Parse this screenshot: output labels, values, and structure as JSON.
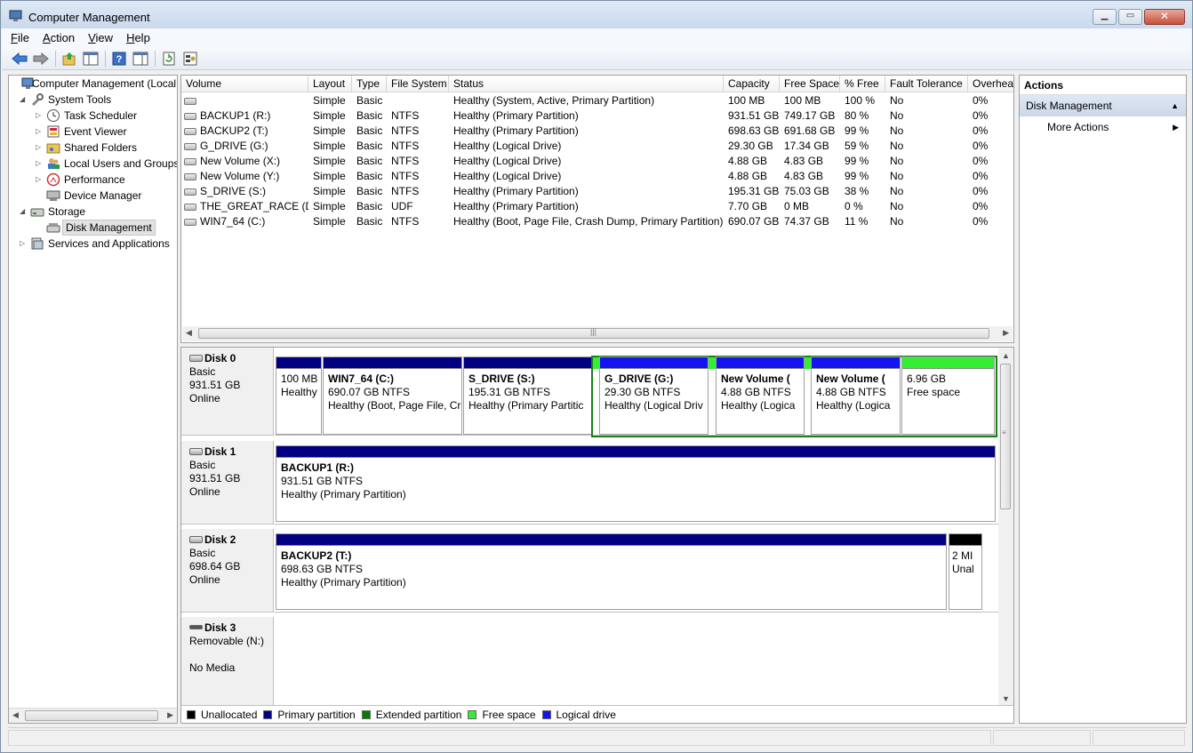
{
  "window": {
    "title": "Computer Management"
  },
  "menu": [
    {
      "key": "F",
      "rest": "ile"
    },
    {
      "key": "A",
      "rest": "ction"
    },
    {
      "key": "V",
      "rest": "iew"
    },
    {
      "key": "H",
      "rest": "elp"
    }
  ],
  "toolbar": [
    "back-icon",
    "forward-icon",
    "up-icon",
    "show-hide-tree-icon",
    "help-icon",
    "show-hide-action-pane-icon",
    "refresh-icon",
    "properties-icon"
  ],
  "tree": [
    {
      "label": "Computer Management (Local",
      "icon": "computer-management-icon",
      "arrow": "",
      "level": 0
    },
    {
      "label": "System Tools",
      "icon": "system-tools-icon",
      "arrow": "◢",
      "level": 1
    },
    {
      "label": "Task Scheduler",
      "icon": "clock-icon",
      "arrow": "▷",
      "level": 2
    },
    {
      "label": "Event Viewer",
      "icon": "event-viewer-icon",
      "arrow": "▷",
      "level": 2
    },
    {
      "label": "Shared Folders",
      "icon": "shared-folders-icon",
      "arrow": "▷",
      "level": 2
    },
    {
      "label": "Local Users and Groups",
      "icon": "users-icon",
      "arrow": "▷",
      "level": 2
    },
    {
      "label": "Performance",
      "icon": "performance-icon",
      "arrow": "▷",
      "level": 2
    },
    {
      "label": "Device Manager",
      "icon": "device-manager-icon",
      "arrow": "",
      "level": 2
    },
    {
      "label": "Storage",
      "icon": "storage-icon",
      "arrow": "◢",
      "level": 1
    },
    {
      "label": "Disk Management",
      "icon": "disk-management-icon",
      "arrow": "",
      "level": 2,
      "selected": true
    },
    {
      "label": "Services and Applications",
      "icon": "services-icon",
      "arrow": "▷",
      "level": 1
    }
  ],
  "volumes": {
    "columns": [
      "Volume",
      "Layout",
      "Type",
      "File System",
      "Status",
      "Capacity",
      "Free Space",
      "% Free",
      "Fault Tolerance",
      "Overhea"
    ],
    "rows": [
      [
        "",
        "Simple",
        "Basic",
        "",
        "Healthy (System, Active, Primary Partition)",
        "100 MB",
        "100 MB",
        "100 %",
        "No",
        "0%"
      ],
      [
        "BACKUP1 (R:)",
        "Simple",
        "Basic",
        "NTFS",
        "Healthy (Primary Partition)",
        "931.51 GB",
        "749.17 GB",
        "80 %",
        "No",
        "0%"
      ],
      [
        "BACKUP2 (T:)",
        "Simple",
        "Basic",
        "NTFS",
        "Healthy (Primary Partition)",
        "698.63 GB",
        "691.68 GB",
        "99 %",
        "No",
        "0%"
      ],
      [
        "G_DRIVE (G:)",
        "Simple",
        "Basic",
        "NTFS",
        "Healthy (Logical Drive)",
        "29.30 GB",
        "17.34 GB",
        "59 %",
        "No",
        "0%"
      ],
      [
        "New Volume (X:)",
        "Simple",
        "Basic",
        "NTFS",
        "Healthy (Logical Drive)",
        "4.88 GB",
        "4.83 GB",
        "99 %",
        "No",
        "0%"
      ],
      [
        "New Volume (Y:)",
        "Simple",
        "Basic",
        "NTFS",
        "Healthy (Logical Drive)",
        "4.88 GB",
        "4.83 GB",
        "99 %",
        "No",
        "0%"
      ],
      [
        "S_DRIVE (S:)",
        "Simple",
        "Basic",
        "NTFS",
        "Healthy (Primary Partition)",
        "195.31 GB",
        "75.03 GB",
        "38 %",
        "No",
        "0%"
      ],
      [
        "THE_GREAT_RACE (D:)",
        "Simple",
        "Basic",
        "UDF",
        "Healthy (Primary Partition)",
        "7.70 GB",
        "0 MB",
        "0 %",
        "No",
        "0%"
      ],
      [
        "WIN7_64 (C:)",
        "Simple",
        "Basic",
        "NTFS",
        "Healthy (Boot, Page File, Crash Dump, Primary Partition)",
        "690.07 GB",
        "74.37 GB",
        "11 %",
        "No",
        "0%"
      ]
    ]
  },
  "disks": [
    {
      "name": "Disk 0",
      "type": "Basic",
      "size": "931.51 GB",
      "state": "Online",
      "partitions": [
        {
          "title": "",
          "line1": "100 MB",
          "line2": "Healthy",
          "kind": "primary"
        },
        {
          "title": "WIN7_64  (C:)",
          "line1": "690.07 GB NTFS",
          "line2": "Healthy (Boot, Page File, Cr",
          "kind": "primary"
        },
        {
          "title": "S_DRIVE  (S:)",
          "line1": "195.31 GB NTFS",
          "line2": "Healthy (Primary Partitic",
          "kind": "primary"
        },
        {
          "title": "G_DRIVE  (G:)",
          "line1": "29.30 GB NTFS",
          "line2": "Healthy (Logical Driv",
          "kind": "logical"
        },
        {
          "title": "New Volume  (",
          "line1": "4.88 GB NTFS",
          "line2": "Healthy (Logica",
          "kind": "logical"
        },
        {
          "title": "New Volume  (",
          "line1": "4.88 GB NTFS",
          "line2": "Healthy (Logica",
          "kind": "logical"
        },
        {
          "title": "",
          "line1": "6.96 GB",
          "line2": "Free space",
          "kind": "free"
        }
      ]
    },
    {
      "name": "Disk 1",
      "type": "Basic",
      "size": "931.51 GB",
      "state": "Online",
      "partitions": [
        {
          "title": "BACKUP1  (R:)",
          "line1": "931.51 GB NTFS",
          "line2": "Healthy (Primary Partition)",
          "kind": "primary"
        }
      ]
    },
    {
      "name": "Disk 2",
      "type": "Basic",
      "size": "698.64 GB",
      "state": "Online",
      "partitions": [
        {
          "title": "BACKUP2  (T:)",
          "line1": "698.63 GB NTFS",
          "line2": "Healthy (Primary Partition)",
          "kind": "primary"
        },
        {
          "title": "",
          "line1": "2 MI",
          "line2": "Unal",
          "kind": "unallocated"
        }
      ]
    },
    {
      "name": "Disk 3",
      "type": "Removable (N:)",
      "size": "",
      "state": "No Media",
      "partitions": []
    }
  ],
  "legend": [
    {
      "label": "Unallocated",
      "color": "#000000"
    },
    {
      "label": "Primary partition",
      "color": "#000080"
    },
    {
      "label": "Extended partition",
      "color": "#008000"
    },
    {
      "label": "Free space",
      "color": "#33ee33"
    },
    {
      "label": "Logical drive",
      "color": "#1414f0"
    }
  ],
  "actions": {
    "header": "Actions",
    "section": "Disk Management",
    "items": [
      "More Actions"
    ]
  },
  "colors": {
    "primary": "#000080",
    "logical": "#1414f0",
    "extended": "#1b7e1b",
    "free": "#33ee33",
    "unallocated": "#000000"
  }
}
